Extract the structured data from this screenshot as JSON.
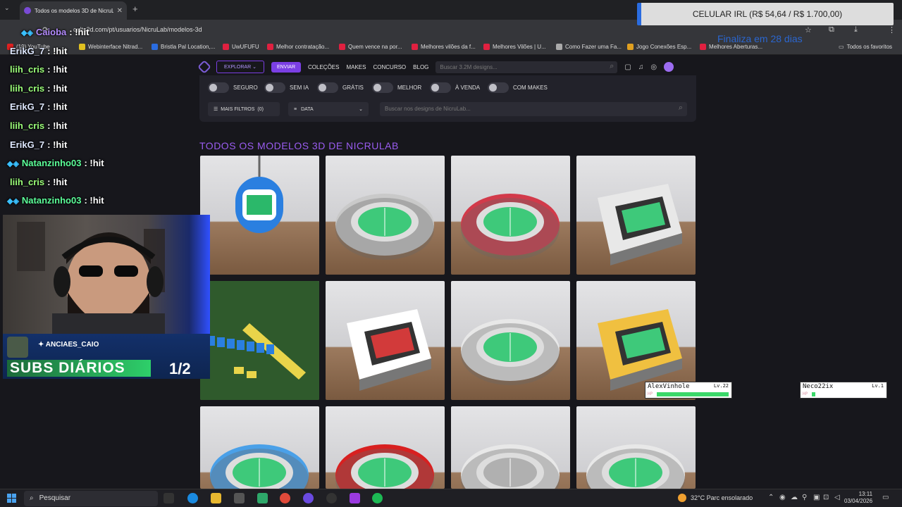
{
  "browser": {
    "tab_title": "Todos os modelos 3D de NicruL",
    "url": "cults3d.com/pt/usuarios/NicruLab/modelos-3d",
    "bookmarks": [
      {
        "label": "(19) YouTube",
        "color": "#e02020"
      },
      {
        "label": "Webinterface Nitrad...",
        "color": "#e0c020"
      },
      {
        "label": "Bristla Pal Location,...",
        "color": "#2a6ce0"
      },
      {
        "label": "UwUFUFU",
        "color": "#e02040"
      },
      {
        "label": "Melhor contratação...",
        "color": "#e02040"
      },
      {
        "label": "Quem vence na por...",
        "color": "#e02040"
      },
      {
        "label": "Melhores vilões da f...",
        "color": "#e02040"
      },
      {
        "label": "Melhores Vilões | U...",
        "color": "#e02040"
      },
      {
        "label": "Como Fazer uma Fa...",
        "color": "#aaaaaa"
      },
      {
        "label": "Jogo Conexões Esp...",
        "color": "#e0a020"
      },
      {
        "label": "Melhores Aberturas...",
        "color": "#e02040"
      }
    ],
    "all_favorites": "Todos os favoritos"
  },
  "site": {
    "nav": {
      "explore": "EXPLORAR",
      "send": "ENVIAR",
      "links": [
        "COLEÇÕES",
        "MAKES",
        "CONCURSO",
        "BLOG"
      ],
      "search_placeholder": "Buscar 3.2M designs..."
    },
    "filters": {
      "toggles": [
        "SEGURO",
        "SEM IA",
        "GRÁTIS",
        "MELHOR",
        "À VENDA",
        "COM MAKES"
      ],
      "more_filters": "MAIS FILTROS",
      "more_filters_count": "(0)",
      "sort": "DATA",
      "search_placeholder": "Buscar nos designs de NicruLab..."
    },
    "heading": "TODOS OS MODELOS 3D DE NICRULAB"
  },
  "overlay": {
    "chat": [
      {
        "user": "Caioba",
        "text": ": !hit",
        "color": "#b48cff",
        "badges": true
      },
      {
        "user": "ErikG_7",
        "text": ": !hit",
        "color": "#dfe8ff",
        "badges": false
      },
      {
        "user": "liih_cris",
        "text": ": !hit",
        "color": "#9cff7a",
        "badges": false
      },
      {
        "user": "liih_cris",
        "text": ": !hit",
        "color": "#9cff7a",
        "badges": false
      },
      {
        "user": "ErikG_7",
        "text": ": !hit",
        "color": "#dfe8ff",
        "badges": false
      },
      {
        "user": "liih_cris",
        "text": ": !hit",
        "color": "#9cff7a",
        "badges": false
      },
      {
        "user": "ErikG_7",
        "text": ": !hit",
        "color": "#dfe8ff",
        "badges": false
      },
      {
        "user": "Natanzinho03",
        "text": ": !hit",
        "color": "#5cff9a",
        "badges": true
      },
      {
        "user": "liih_cris",
        "text": ": !hit",
        "color": "#9cff7a",
        "badges": false
      },
      {
        "user": "Natanzinho03",
        "text": ": !hit",
        "color": "#5cff9a",
        "badges": true
      }
    ],
    "social_handle": "ANCIAES_CAIO",
    "subs_label": "SUBS DIÁRIOS",
    "subs_count": "1/2",
    "goal_title": "CELULAR IRL (R$ 54,64 / R$ 1.700,00)",
    "goal_sub": "Finaliza em 28 dias",
    "players": [
      {
        "name": "AlexVinhole",
        "level": "Lv.22",
        "hp": 1.0
      },
      {
        "name": "Neco22ix",
        "level": "Lv.1",
        "hp": 0.05
      }
    ]
  },
  "taskbar": {
    "search": "Pesquisar",
    "weather": "32°C  Parc ensolarado",
    "time": "13:11",
    "date": "03/04/2026"
  },
  "models": [
    {
      "style": "keychain",
      "pitch": "#2bb86a",
      "ring": "#2a7fe0"
    },
    {
      "style": "oval",
      "pitch": "#3ec97a",
      "ring": "#c9c9c9"
    },
    {
      "style": "oval",
      "pitch": "#3ec97a",
      "ring": "#d23a4a"
    },
    {
      "style": "box",
      "pitch": "#3ec97a",
      "ring": "#e8e8e8"
    },
    {
      "style": "cards",
      "pitch": "#e9d44a",
      "ring": "#2a7fe0"
    },
    {
      "style": "box",
      "pitch": "#d23a3a",
      "ring": "#ffffff"
    },
    {
      "style": "oval",
      "pitch": "#3ec97a",
      "ring": "#e8e8e8"
    },
    {
      "style": "box",
      "pitch": "#3ec97a",
      "ring": "#f0c040"
    },
    {
      "style": "oval",
      "pitch": "#3ec97a",
      "ring": "#4aa0e8"
    },
    {
      "style": "oval",
      "pitch": "#3ec97a",
      "ring": "#d82020"
    },
    {
      "style": "oval",
      "pitch": "#b0b0b0",
      "ring": "#e8e8e8"
    },
    {
      "style": "oval",
      "pitch": "#3ec97a",
      "ring": "#e8e8e8"
    }
  ]
}
